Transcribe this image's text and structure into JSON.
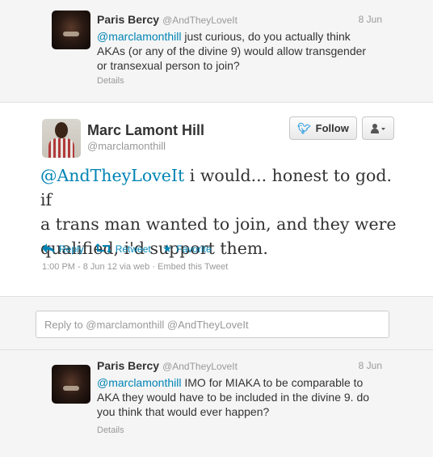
{
  "context_top": {
    "name": "Paris Bercy",
    "handle": "@AndTheyLoveIt",
    "date": "8 Jun",
    "mention": "@marclamonthill",
    "text_line1": " just curious, do you actually think",
    "text_line2": "AKAs (or any of the divine 9) would allow transgender",
    "text_line3": "or transexual person to join?",
    "details": "Details"
  },
  "main": {
    "name": "Marc Lamont Hill",
    "handle": "@marclamonthill",
    "follow_label": "Follow",
    "mention": "@AndTheyLoveIt",
    "text_line1": " i would... honest to god. if",
    "text_line2": "a trans man wanted to join, and they were",
    "text_line3": "qualified, i'd support them.",
    "actions": {
      "reply": "Reply",
      "retweet": "Retweet",
      "favorite": "Favorite"
    },
    "meta": "1:00 PM - 8 Jun 12 via web · Embed this Tweet"
  },
  "reply": {
    "placeholder": "Reply to @marclamonthill @AndTheyLoveIt"
  },
  "context_bottom": {
    "name": "Paris Bercy",
    "handle": "@AndTheyLoveIt",
    "date": "8 Jun",
    "mention": "@marclamonthill",
    "text_line1": " IMO for MIAKA to be comparable to",
    "text_line2": "AKA they would have to be included in the divine 9. do",
    "text_line3": "you think that would ever happen?",
    "details": "Details"
  },
  "icons": {
    "follow": "bird-icon",
    "user_dropdown": "user-dropdown-icon",
    "reply": "reply-arrow-icon",
    "retweet": "retweet-icon",
    "favorite": "star-icon"
  },
  "colors": {
    "link": "#0084b4",
    "muted": "#999999",
    "background": "#f5f5f5"
  }
}
